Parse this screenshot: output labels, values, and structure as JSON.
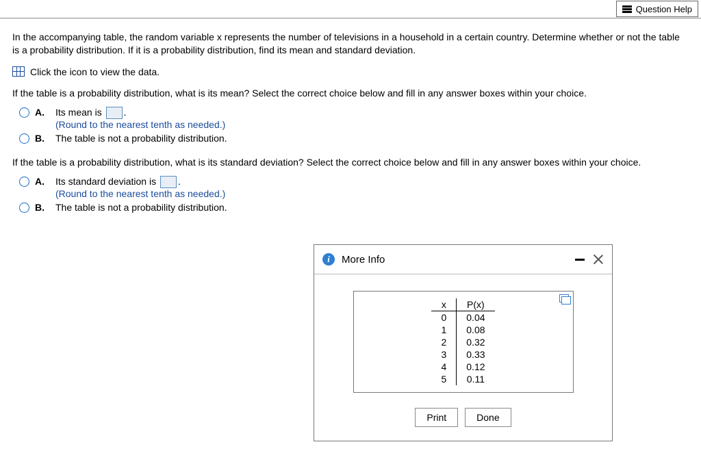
{
  "header": {
    "question_help_label": "Question Help"
  },
  "question": {
    "intro": "In the accompanying table, the random variable x represents the number of televisions in a household in a certain country. Determine whether or not the table is a probability distribution. If it is a probability distribution, find its mean and standard deviation.",
    "data_link": "Click the icon to view the data.",
    "mean_prompt": "If the table is a probability distribution, what is its mean? Select the correct choice below and fill in any answer boxes within your choice.",
    "sd_prompt": "If the table is a probability distribution, what is its standard deviation? Select the correct choice below and fill in any answer boxes within your choice.",
    "mean_choices": {
      "A_prefix": "Its mean is ",
      "A_suffix": ".",
      "A_hint": "(Round to the nearest tenth as needed.)",
      "B": "The table is not a probability distribution."
    },
    "sd_choices": {
      "A_prefix": "Its standard deviation is ",
      "A_suffix": ".",
      "A_hint": "(Round to the nearest tenth as needed.)",
      "B": "The table is not a probability distribution."
    },
    "labels": {
      "A": "A.",
      "B": "B."
    }
  },
  "popup": {
    "title": "More Info",
    "print": "Print",
    "done": "Done",
    "table": {
      "x_header": "x",
      "p_header": "P(x)",
      "rows": [
        {
          "x": "0",
          "p": "0.04"
        },
        {
          "x": "1",
          "p": "0.08"
        },
        {
          "x": "2",
          "p": "0.32"
        },
        {
          "x": "3",
          "p": "0.33"
        },
        {
          "x": "4",
          "p": "0.12"
        },
        {
          "x": "5",
          "p": "0.11"
        }
      ]
    }
  }
}
